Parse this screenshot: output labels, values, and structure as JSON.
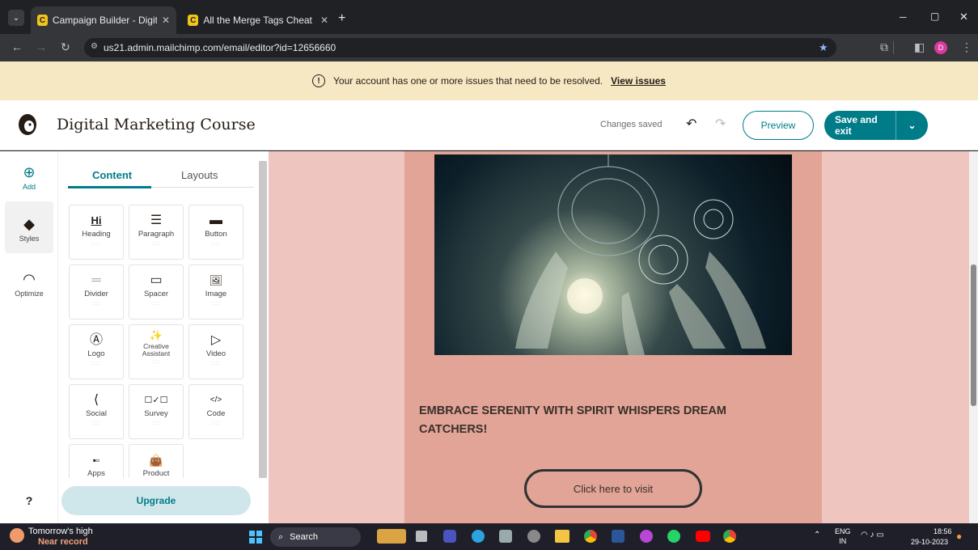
{
  "browser": {
    "tabs": [
      {
        "title": "Campaign Builder - Digital Ma",
        "favicon": "C"
      },
      {
        "title": "All the Merge Tags Cheat Shee",
        "favicon": "C"
      }
    ],
    "url": "us21.admin.mailchimp.com/email/editor?id=12656660",
    "profile_initial": "D"
  },
  "banner": {
    "message": "Your account has one or more issues that need to be resolved.",
    "link": "View issues"
  },
  "header": {
    "campaign_title": "Digital Marketing Course",
    "status": "Changes saved",
    "preview_label": "Preview",
    "save_exit_label": "Save and exit"
  },
  "rail": {
    "add": "Add",
    "styles": "Styles",
    "optimize": "Optimize",
    "help": "?"
  },
  "panel": {
    "tabs": [
      "Content",
      "Layouts"
    ],
    "blocks": [
      {
        "label": "Heading",
        "icon": "Hi"
      },
      {
        "label": "Paragraph",
        "icon": "☰"
      },
      {
        "label": "Button",
        "icon": "▬"
      },
      {
        "label": "Divider",
        "icon": "═"
      },
      {
        "label": "Spacer",
        "icon": "▭"
      },
      {
        "label": "Image",
        "icon": "🖼"
      },
      {
        "label": "Logo",
        "icon": "Ⓐ"
      },
      {
        "label": "Creative Assistant",
        "icon": "✨"
      },
      {
        "label": "Video",
        "icon": "▷"
      },
      {
        "label": "Social",
        "icon": "⟨"
      },
      {
        "label": "Survey",
        "icon": "☐✓☐"
      },
      {
        "label": "Code",
        "icon": "</>"
      },
      {
        "label": "Apps",
        "icon": "▪▫"
      },
      {
        "label": "Product",
        "icon": "👜"
      }
    ],
    "upgrade_label": "Upgrade"
  },
  "email": {
    "headline": "EMBRACE SERENITY WITH SPIRIT WHISPERS DREAM CATCHERS!",
    "cta_label": "Click here to visit"
  },
  "taskbar": {
    "weather_line1": "Tomorrow's high",
    "weather_line2": "Near record",
    "search": "Search",
    "lang1": "ENG",
    "lang2": "IN",
    "time": "18:56",
    "date": "29-10-2023"
  },
  "colors": {
    "accent": "#007c89",
    "banner": "#f6e8c3",
    "canvas_bg": "#eec5bf",
    "email_body": "#e1a497"
  }
}
